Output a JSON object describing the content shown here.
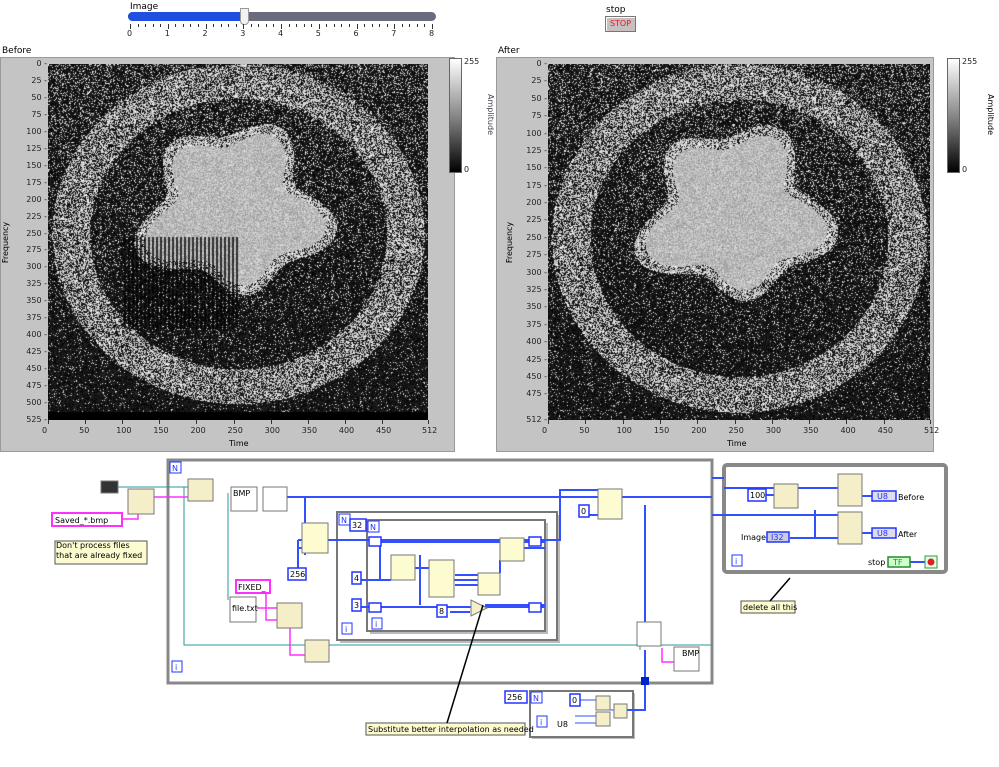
{
  "slider": {
    "label": "Image",
    "value": 3,
    "min": 0,
    "max": 8,
    "ticks": [
      "0",
      "1",
      "2",
      "3",
      "4",
      "5",
      "6",
      "7",
      "8"
    ]
  },
  "stop": {
    "label": "stop",
    "button": "STOP"
  },
  "graphs": {
    "before": {
      "title": "Before",
      "ylabel": "Frequency",
      "xlabel": "Time",
      "colorbar_label": "Amplitude",
      "colorbar_ticks": [
        "255",
        "0"
      ],
      "ymax": 525,
      "yticks": [
        "0",
        "25",
        "50",
        "75",
        "100",
        "125",
        "150",
        "175",
        "200",
        "225",
        "250",
        "275",
        "300",
        "325",
        "350",
        "375",
        "400",
        "425",
        "450",
        "475",
        "500",
        "525"
      ],
      "xticks": [
        "0",
        "50",
        "100",
        "150",
        "200",
        "250",
        "300",
        "350",
        "400",
        "450",
        "512"
      ]
    },
    "after": {
      "title": "After",
      "ylabel": "Frequency",
      "xlabel": "Time",
      "colorbar_label": "Amplitude",
      "colorbar_ticks": [
        "255",
        "0"
      ],
      "ymax": 512,
      "yticks": [
        "0",
        "25",
        "50",
        "75",
        "100",
        "125",
        "150",
        "175",
        "200",
        "225",
        "250",
        "275",
        "300",
        "325",
        "350",
        "375",
        "400",
        "425",
        "450",
        "475",
        "512"
      ],
      "xticks": [
        "0",
        "50",
        "100",
        "150",
        "200",
        "250",
        "300",
        "350",
        "400",
        "450",
        "512"
      ]
    }
  },
  "diagram": {
    "loop_N": "N",
    "loop_i": "i",
    "pattern": "Saved_*.bmp",
    "comment_skip": "Don't process files that are already fixed",
    "prefix": "FIXED_",
    "file_node": "file.txt",
    "bmp": "BMP",
    "const_256": "256",
    "const_32": "32",
    "const_4": "4",
    "const_3": "3",
    "const_8": "8",
    "const_0": "0",
    "const_100": "100",
    "comment_interp": "Substitute better interpolation as needed",
    "comment_delete": "delete all this",
    "image_label": "Image",
    "image_type": "I32",
    "before_label": "Before",
    "after_label": "After",
    "u8": "U8",
    "stop_label": "stop",
    "tf": "TF",
    "bottom_256": "256",
    "bottom_0": "0"
  }
}
